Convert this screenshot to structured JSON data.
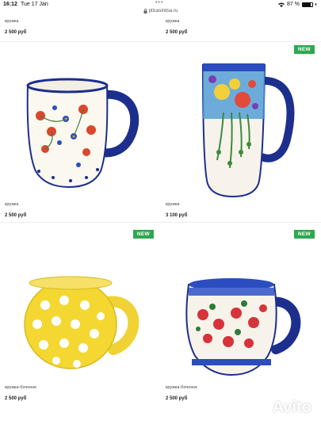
{
  "status": {
    "time": "16:12",
    "date": "Tue 17 Jan",
    "battery": "87 %",
    "battery_level": 0.87
  },
  "browser": {
    "url": "pticasinitsa.ru"
  },
  "products": [
    {
      "label": "кружка",
      "price": "2 500 руб"
    },
    {
      "label": "кружка",
      "price": "2 500 руб"
    },
    {
      "label": "кружка",
      "price": "2 500 руб",
      "badge": ""
    },
    {
      "label": "кружка",
      "price": "3 100 руб",
      "badge": "NEW"
    },
    {
      "label": "кружка-бочонок",
      "price": "2 500 руб",
      "badge": "NEW"
    },
    {
      "label": "кружка-бочонок",
      "price": "2 500 руб",
      "badge": "NEW"
    }
  ],
  "watermark": "Avito",
  "colors": {
    "badge": "#2ea84f",
    "cobalt": "#1d2f8c"
  }
}
